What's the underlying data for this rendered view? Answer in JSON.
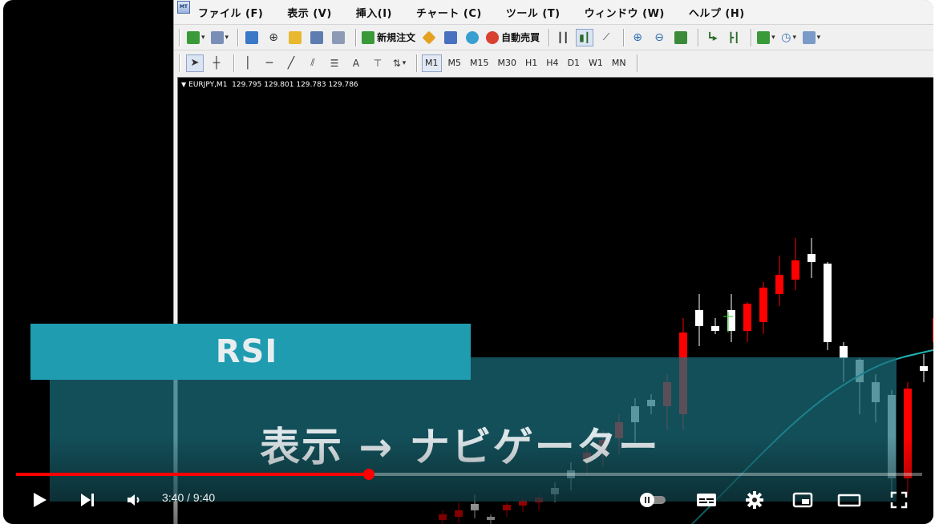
{
  "menu": {
    "items": [
      "ファイル (F)",
      "表示 (V)",
      "挿入(I)",
      "チャート (C)",
      "ツール (T)",
      "ウィンドウ (W)",
      "ヘルプ (H)"
    ]
  },
  "toolbar": {
    "new_order_label": "新規注文",
    "auto_trade_label": "自動売買",
    "text_tool_label": "A",
    "timeframes": [
      "M1",
      "M5",
      "M15",
      "M30",
      "H1",
      "H4",
      "D1",
      "W1",
      "MN"
    ],
    "active_timeframe": "M1"
  },
  "chart": {
    "symbol": "EURJPY,M1",
    "open": "129.795",
    "high": "129.801",
    "low": "129.783",
    "close": "129.786",
    "bull_color": "#ffffff",
    "bear_color": "#ff0000",
    "ma_color": "#1fb5b5"
  },
  "overlay": {
    "banner_title": "RSI",
    "caption": "表示 → ナビゲーター",
    "banner_color": "#1f9cb0"
  },
  "player": {
    "time": "3:40 / 9:40",
    "progress_fraction": 0.389,
    "accent_color": "#ff0000"
  }
}
